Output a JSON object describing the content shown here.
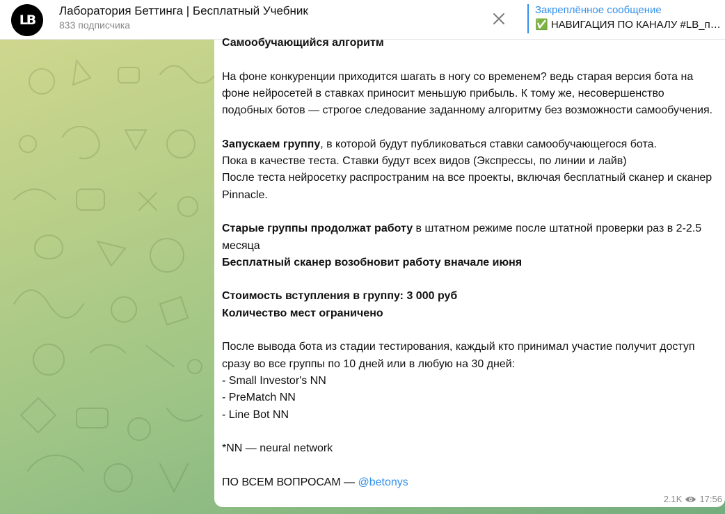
{
  "header": {
    "avatar_text": "LB",
    "title": "Лаборатория Беттинга | Бесплатный Учебник",
    "subscribers": "833 подписчика",
    "close_icon": "close-icon",
    "pinned_label": "Закреплённое сообщение",
    "pinned_text": "✅ НАВИГАЦИЯ ПО КАНАЛУ #LB_п…"
  },
  "message": {
    "heading": "Самообучающийся алгоритм",
    "p1": "На фоне конкуренции приходится шагать в ногу со временем? ведь старая версия бота на фоне нейросетей в ставках приносит меньшую прибыль. К тому же, несовершенство подобных ботов — строгое следование заданному алгоритму без возможности самообучения.",
    "p2_bold": "Запускаем группу",
    "p2_rest": ", в которой будут публиковаться ставки самообучающегося бота.",
    "p2_line2": "Пока в качестве теста. Ставки будут всех видов (Экспрессы, по линии и лайв)",
    "p2_line3": "После теста нейросетку распространим на все проекты, включая бесплатный сканер и сканер Pinnacle.",
    "p3_bold": "Старые группы продолжат работу",
    "p3_rest": " в штатном режиме после штатной проверки раз в 2-2.5 месяца",
    "p3_line2": "Бесплатный сканер возобновит работу вначале июня",
    "p4_line1": "Стоимость вступления в группу: 3 000 руб",
    "p4_line2": "Количество мест ограничено",
    "p5_line1": "После вывода бота из стадии тестирования, каждый кто принимал участие получит доступ сразу во все группы по 10 дней или в любую на 30 дней:",
    "bots": [
      "- Small Investor's NN",
      "- PreMatch NN",
      "- Line Bot NN"
    ],
    "footnote": "*NN — neural network",
    "contact_prefix": "ПО ВСЕМ ВОПРОСАМ — ",
    "contact_link": "@betonys",
    "views": "2.1K",
    "time": "17:56"
  },
  "colors": {
    "accent": "#3390ec",
    "bg_top": "#d3d88f",
    "bg_bottom": "#74ad7e"
  }
}
